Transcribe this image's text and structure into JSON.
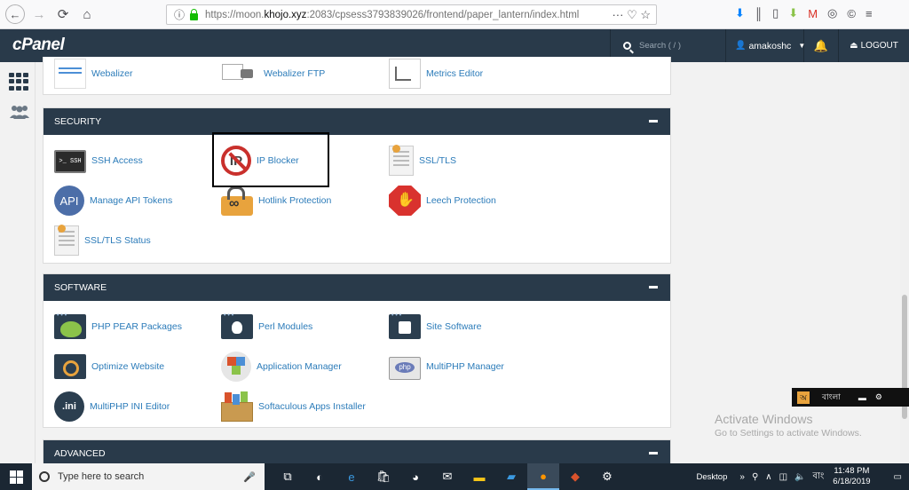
{
  "browser": {
    "url_prefix": "https://moon.",
    "url_host": "khojo.xyz",
    "url_suffix": ":2083/cpsess3793839026/frontend/paper_lantern/index.html",
    "url_actions": "··· ♡ ☆"
  },
  "header": {
    "logo": "cPanel",
    "search_placeholder": "Search ( / )",
    "username": "amakoshc",
    "logout": "LOGOUT"
  },
  "top_items": [
    {
      "label": "Webalizer",
      "icon": "webalizer-icon"
    },
    {
      "label": "Webalizer FTP",
      "icon": "truck-icon"
    },
    {
      "label": "Metrics Editor",
      "icon": "chart-icon"
    }
  ],
  "security": {
    "title": "SECURITY",
    "items": [
      {
        "label": "SSH Access",
        "icon": "terminal-icon"
      },
      {
        "label": "IP Blocker",
        "icon": "no-ip-icon"
      },
      {
        "label": "SSL/TLS",
        "icon": "certificate-icon"
      },
      {
        "label": "Manage API Tokens",
        "icon": "api-icon"
      },
      {
        "label": "Hotlink Protection",
        "icon": "padlock-link-icon"
      },
      {
        "label": "Leech Protection",
        "icon": "stop-hand-icon"
      },
      {
        "label": "SSL/TLS Status",
        "icon": "certificate-status-icon"
      }
    ]
  },
  "software": {
    "title": "SOFTWARE",
    "items": [
      {
        "label": "PHP PEAR Packages",
        "icon": "pear-icon"
      },
      {
        "label": "Perl Modules",
        "icon": "onion-icon"
      },
      {
        "label": "Site Software",
        "icon": "puzzle-icon"
      },
      {
        "label": "Optimize Website",
        "icon": "magnifier-graph-icon"
      },
      {
        "label": "Application Manager",
        "icon": "cubes-icon"
      },
      {
        "label": "MultiPHP Manager",
        "icon": "php-icon"
      },
      {
        "label": "MultiPHP INI Editor",
        "icon": "ini-icon"
      },
      {
        "label": "Softaculous Apps Installer",
        "icon": "box-icon"
      }
    ]
  },
  "advanced": {
    "title": "ADVANCED"
  },
  "watermark": {
    "line1": "Activate Windows",
    "line2": "Go to Settings to activate Windows."
  },
  "taskbar": {
    "search_placeholder": "Type here to search",
    "desktop": "Desktop",
    "time": "11:48 PM",
    "date": "6/18/2019",
    "lang": "বাং"
  },
  "langbar": {
    "text": "বাংলা"
  }
}
